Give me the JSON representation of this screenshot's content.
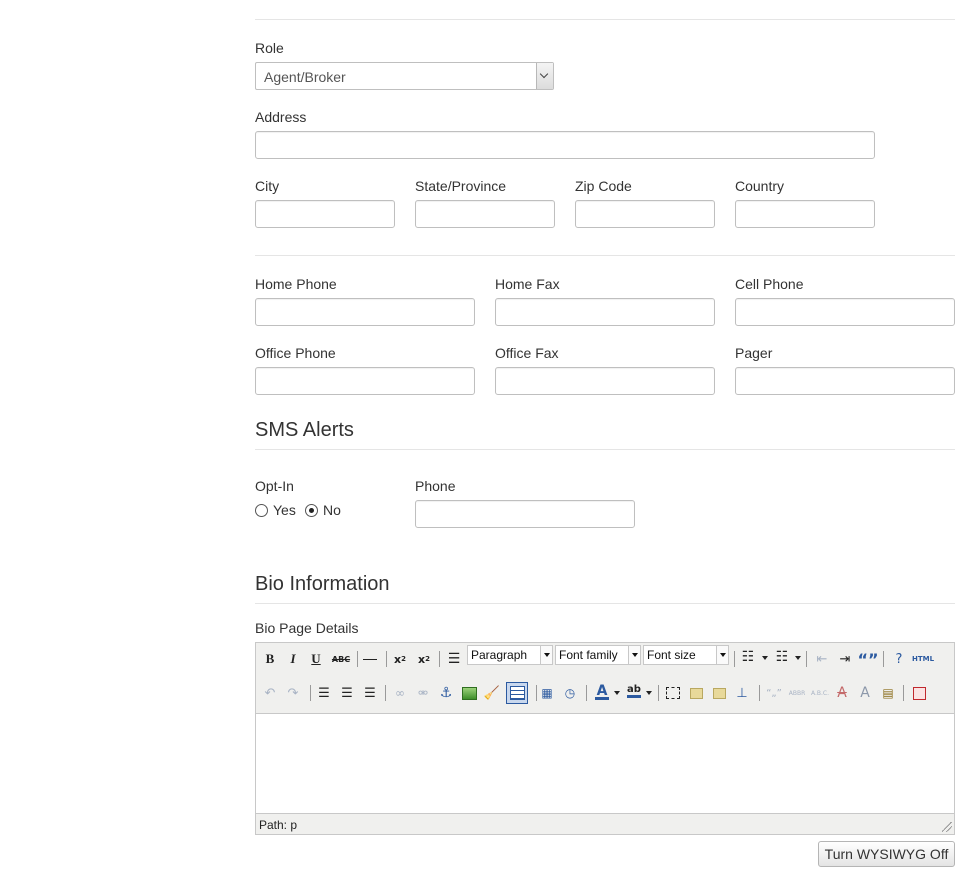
{
  "role": {
    "label": "Role",
    "selected": "Agent/Broker"
  },
  "address": {
    "label": "Address",
    "value": ""
  },
  "location": {
    "city": "City",
    "state": "State/Province",
    "zip": "Zip Code",
    "country": "Country"
  },
  "phones": {
    "home_phone": "Home Phone",
    "home_fax": "Home Fax",
    "cell_phone": "Cell Phone",
    "office_phone": "Office Phone",
    "office_fax": "Office Fax",
    "pager": "Pager"
  },
  "sms": {
    "heading": "SMS Alerts",
    "optin_label": "Opt-In",
    "yes": "Yes",
    "no": "No",
    "selected": "No",
    "phone_label": "Phone"
  },
  "bio": {
    "heading": "Bio Information",
    "details_label": "Bio Page Details",
    "format_select": "Paragraph",
    "font_family_select": "Font family",
    "font_size_select": "Font size",
    "path_label": "Path: p",
    "wysiwyg_button": "Turn WYSIWYG Off"
  },
  "toolbar": {
    "bold": "B",
    "italic": "I",
    "underline": "U",
    "strike": "ABC",
    "html": "HTML",
    "abbr": "ABBR",
    "acronym": "A.B.C.",
    "quote": "“”",
    "cite": "“„”"
  }
}
